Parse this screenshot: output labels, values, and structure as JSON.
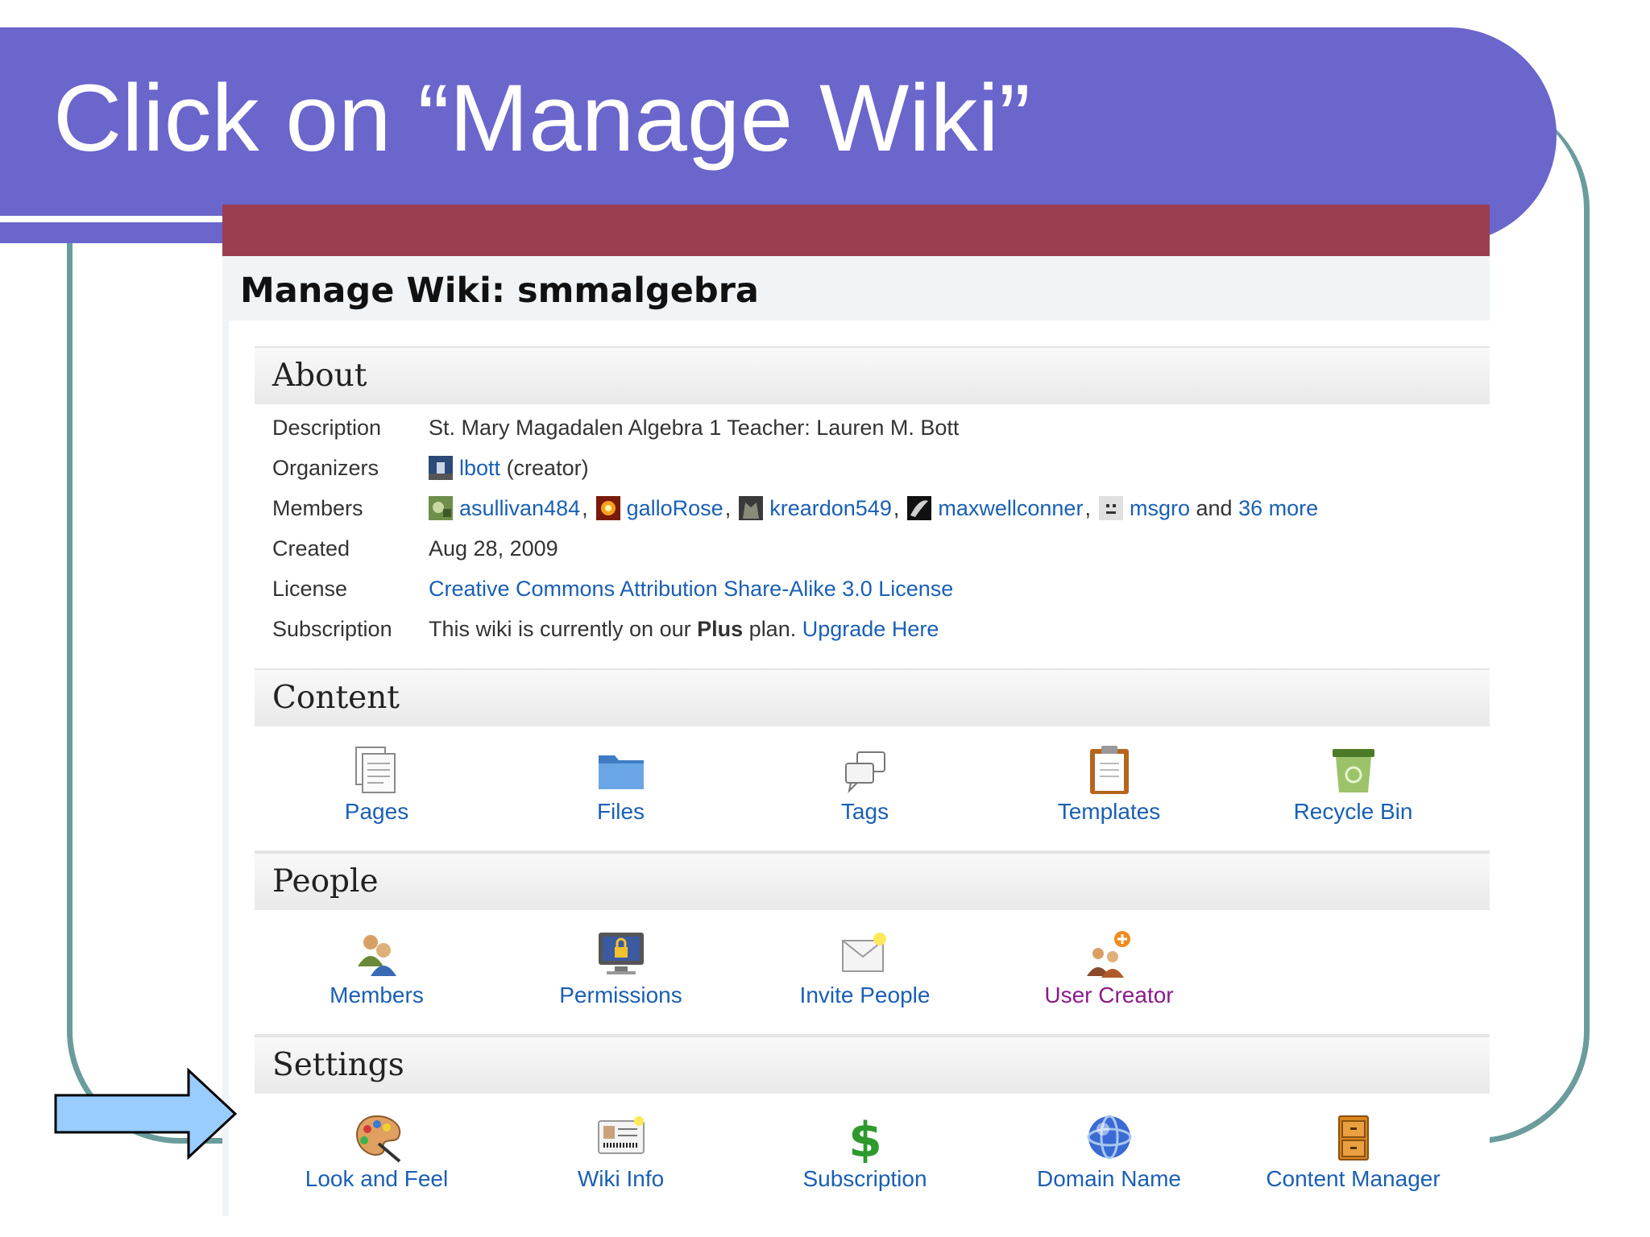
{
  "slide": {
    "title": "Click on “Manage Wiki”"
  },
  "wiki": {
    "heading": "Manage Wiki: smmalgebra",
    "about": {
      "header": "About",
      "description": {
        "label": "Description",
        "value": "St. Mary Magadalen Algebra 1 Teacher: Lauren M. Bott"
      },
      "organizers": {
        "label": "Organizers",
        "name": "lbott",
        "role": "(creator)"
      },
      "members": {
        "label": "Members",
        "names": [
          "asullivan484",
          "galloRose",
          "kreardon549",
          "maxwellconner",
          "msgro"
        ],
        "and": "and",
        "more": "36 more"
      },
      "created": {
        "label": "Created",
        "value": "Aug 28, 2009"
      },
      "license": {
        "label": "License",
        "value": "Creative Commons Attribution Share-Alike 3.0 License"
      },
      "subscription": {
        "label": "Subscription",
        "text_before": "This wiki is currently on our",
        "plan": "Plus",
        "text_after": "plan.",
        "upgrade": "Upgrade Here"
      }
    },
    "content": {
      "header": "Content",
      "items": [
        {
          "label": "Pages",
          "icon": "pages-icon"
        },
        {
          "label": "Files",
          "icon": "folder-icon"
        },
        {
          "label": "Tags",
          "icon": "tags-icon"
        },
        {
          "label": "Templates",
          "icon": "clipboard-icon"
        },
        {
          "label": "Recycle Bin",
          "icon": "recycle-bin-icon"
        }
      ]
    },
    "people": {
      "header": "People",
      "items": [
        {
          "label": "Members",
          "icon": "members-icon"
        },
        {
          "label": "Permissions",
          "icon": "lock-monitor-icon"
        },
        {
          "label": "Invite People",
          "icon": "envelope-icon"
        },
        {
          "label": "User Creator",
          "icon": "user-creator-icon"
        }
      ]
    },
    "settings": {
      "header": "Settings",
      "items": [
        {
          "label": "Look and Feel",
          "icon": "palette-icon"
        },
        {
          "label": "Wiki Info",
          "icon": "id-card-icon"
        },
        {
          "label": "Subscription",
          "icon": "dollar-icon"
        },
        {
          "label": "Domain Name",
          "icon": "globe-icon"
        },
        {
          "label": "Content Manager",
          "icon": "cabinet-icon"
        }
      ]
    }
  },
  "colors": {
    "banner": "#6b66cc",
    "frame": "#6a9c9c",
    "maroon_bar": "#9c3e50",
    "link": "#1a5fb4",
    "user_creator_link": "#8a1c8a",
    "arrow_fill": "#99ccff"
  }
}
